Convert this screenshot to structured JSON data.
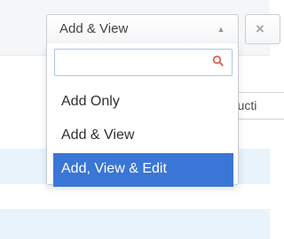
{
  "background": {
    "partial_field_text": "tructi"
  },
  "select": {
    "current_value": "Add & View",
    "caret_icon": "chevron-down-icon"
  },
  "side_button": {
    "icon": "close-icon",
    "label": "×"
  },
  "dropdown": {
    "search": {
      "value": "",
      "placeholder": "",
      "icon": "search-icon"
    },
    "options": [
      {
        "label": "Add Only",
        "selected": false
      },
      {
        "label": "Add & View",
        "selected": false
      },
      {
        "label": "Add, View & Edit",
        "selected": true
      }
    ]
  },
  "colors": {
    "highlight": "#3a76d6",
    "background_band": "#e8f3fb",
    "search_border": "#a9c7e6",
    "search_icon": "#d9665d"
  }
}
